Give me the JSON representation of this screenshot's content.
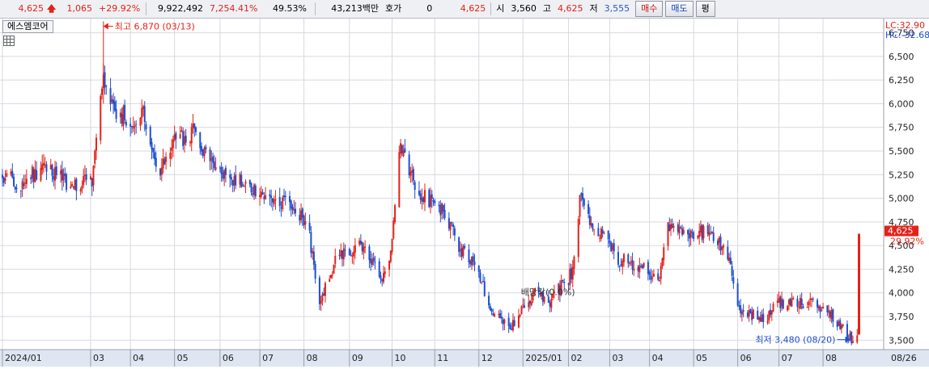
{
  "topbar": {
    "price": "4,625",
    "change": "1,065",
    "change_pct": "+29.92%",
    "volume": "9,922,492",
    "volume_ratio": "7,254.41%",
    "turnover": "49.53%",
    "amount": "43,213백만",
    "quote_label": "호가",
    "quote_value": "0",
    "quote_price": "4,625",
    "open_label": "시",
    "open_value": "3,560",
    "high_label": "고",
    "high_value": "4,625",
    "low_label": "저",
    "low_value": "3,555",
    "buy_label": "매수",
    "sell_label": "매도",
    "avg_label": "평"
  },
  "stock_name": "에스엠코어",
  "colors": {
    "up": "#e2231a",
    "down": "#1f4fd0",
    "grid": "#d6d9e0",
    "axis_bg": "#dfe6f2"
  },
  "chart_data": {
    "type": "candlestick",
    "ylim": [
      3400,
      6900
    ],
    "yticks": [
      3500,
      3750,
      4000,
      4250,
      4500,
      4750,
      5000,
      5250,
      5500,
      5750,
      6000,
      6250,
      6500,
      6750
    ],
    "ytick_labels": [
      "3,500",
      "3,750",
      "4,000",
      "4,250",
      "4,500",
      "4,750",
      "5,000",
      "5,250",
      "5,500",
      "5,750",
      "6,000",
      "6,250",
      "6,500",
      "6,750"
    ],
    "x_start": "2024-01-02",
    "x_end": "2025-08-26",
    "xticks": [
      {
        "label": "2024/01",
        "date": "2024-01-02"
      },
      {
        "label": "03",
        "date": "2024-03-04"
      },
      {
        "label": "04",
        "date": "2024-04-01"
      },
      {
        "label": "05",
        "date": "2024-05-02"
      },
      {
        "label": "06",
        "date": "2024-06-03"
      },
      {
        "label": "07",
        "date": "2024-07-01"
      },
      {
        "label": "08",
        "date": "2024-08-01"
      },
      {
        "label": "09",
        "date": "2024-09-02"
      },
      {
        "label": "10",
        "date": "2024-10-02"
      },
      {
        "label": "11",
        "date": "2024-11-01"
      },
      {
        "label": "12",
        "date": "2024-12-02"
      },
      {
        "label": "2025/01",
        "date": "2025-01-02"
      },
      {
        "label": "02",
        "date": "2025-02-03"
      },
      {
        "label": "03",
        "date": "2025-03-04"
      },
      {
        "label": "04",
        "date": "2025-04-01"
      },
      {
        "label": "05",
        "date": "2025-05-02"
      },
      {
        "label": "06",
        "date": "2025-06-02"
      },
      {
        "label": "07",
        "date": "2025-07-01"
      },
      {
        "label": "08",
        "date": "2025-08-01"
      }
    ],
    "last_date_label": "08/26",
    "path": [
      [
        "2024-01-02",
        5250
      ],
      [
        "2024-01-15",
        5150
      ],
      [
        "2024-02-01",
        5350
      ],
      [
        "2024-02-20",
        5120
      ],
      [
        "2024-03-05",
        5200
      ],
      [
        "2024-03-13",
        6300
      ],
      [
        "2024-03-20",
        5900
      ],
      [
        "2024-04-01",
        5850
      ],
      [
        "2024-04-10",
        5900
      ],
      [
        "2024-04-20",
        5200
      ],
      [
        "2024-05-02",
        5600
      ],
      [
        "2024-05-15",
        5700
      ],
      [
        "2024-06-01",
        5300
      ],
      [
        "2024-06-20",
        5150
      ],
      [
        "2024-07-10",
        5000
      ],
      [
        "2024-07-25",
        4950
      ],
      [
        "2024-08-05",
        4600
      ],
      [
        "2024-08-12",
        3900
      ],
      [
        "2024-08-25",
        4400
      ],
      [
        "2024-09-10",
        4480
      ],
      [
        "2024-09-25",
        4150
      ],
      [
        "2024-10-02",
        4500
      ],
      [
        "2024-10-08",
        5600
      ],
      [
        "2024-10-20",
        5050
      ],
      [
        "2024-11-05",
        4900
      ],
      [
        "2024-11-20",
        4450
      ],
      [
        "2024-12-01",
        4250
      ],
      [
        "2024-12-10",
        3800
      ],
      [
        "2024-12-25",
        3650
      ],
      [
        "2025-01-10",
        4000
      ],
      [
        "2025-01-20",
        3900
      ],
      [
        "2025-02-05",
        4200
      ],
      [
        "2025-02-12",
        5100
      ],
      [
        "2025-02-20",
        4600
      ],
      [
        "2025-03-01",
        4650
      ],
      [
        "2025-03-10",
        4350
      ],
      [
        "2025-03-25",
        4300
      ],
      [
        "2025-04-07",
        4100
      ],
      [
        "2025-04-14",
        4700
      ],
      [
        "2025-04-25",
        4600
      ],
      [
        "2025-05-15",
        4650
      ],
      [
        "2025-05-28",
        4300
      ],
      [
        "2025-06-02",
        3850
      ],
      [
        "2025-06-20",
        3700
      ],
      [
        "2025-07-01",
        3900
      ],
      [
        "2025-07-20",
        3900
      ],
      [
        "2025-08-05",
        3800
      ],
      [
        "2025-08-20",
        3520
      ],
      [
        "2025-08-25",
        3560
      ],
      [
        "2025-08-26",
        4625
      ]
    ],
    "last_candle": {
      "date": "2025-08-26",
      "open": 3560,
      "high": 4625,
      "low": 3555,
      "close": 4625
    },
    "annotations": {
      "high": {
        "label": "최고 6,870 (03/13)",
        "date": "2024-03-13",
        "value": 6870
      },
      "low": {
        "label": "최저 3,480 (08/20)",
        "date": "2025-08-20",
        "value": 3480
      },
      "exdividend": {
        "label": "배당락(0.0%)",
        "date": "2024-12-27"
      }
    },
    "right_labels": {
      "lc": "LC:32.90",
      "hc": "HC:-32.68",
      "price_tag": "4,625",
      "pct_tag": "29.92%"
    }
  }
}
